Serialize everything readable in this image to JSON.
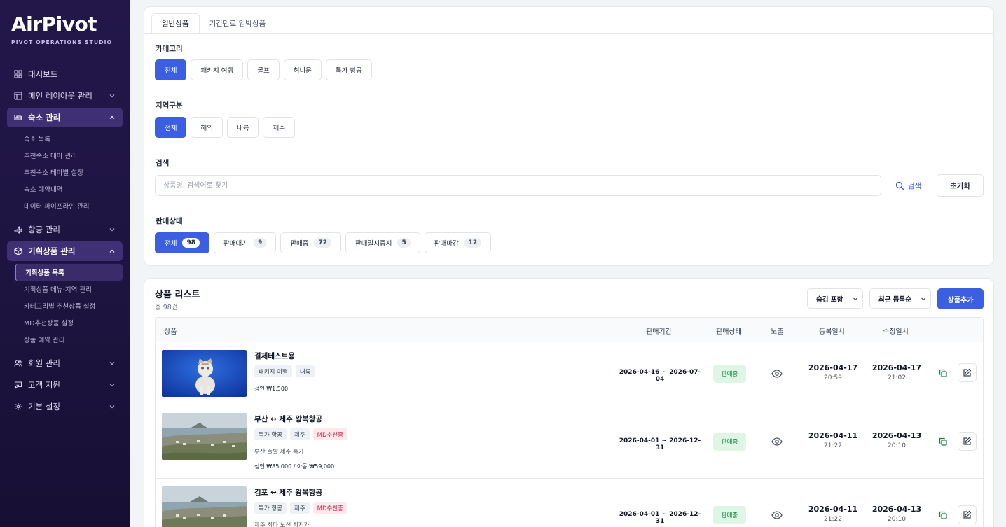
{
  "brand": {
    "name": "AirPivot",
    "tagline": "PIVOT OPERATIONS STUDIO"
  },
  "sidebar": {
    "items": [
      {
        "label": "대시보드",
        "icon": "grid-icon"
      },
      {
        "label": "메인 레이아웃 관리",
        "icon": "layout-icon"
      },
      {
        "label": "숙소 관리",
        "icon": "bed-icon"
      },
      {
        "label": "항공 관리",
        "icon": "plane-icon"
      },
      {
        "label": "기획상품 관리",
        "icon": "box-icon"
      },
      {
        "label": "회원 관리",
        "icon": "users-icon"
      },
      {
        "label": "고객 지원",
        "icon": "chat-icon"
      },
      {
        "label": "기본 설정",
        "icon": "gear-icon"
      }
    ],
    "lodging_sub": [
      "숙소 목록",
      "추천숙소 테마 관리",
      "추천숙소 테마별 설정",
      "숙소 예약내역",
      "데이터 파이프라인 관리"
    ],
    "product_sub": [
      "기획상품 목록",
      "기획상품 메뉴-지역 관리",
      "카테고리별 추천상품 설정",
      "MD추천상품 설정",
      "상품 예약 관리"
    ]
  },
  "tabs": [
    "일반상품",
    "기간만료 임박상품"
  ],
  "filters": {
    "category_label": "카테고리",
    "categories": [
      "전체",
      "패키지 여행",
      "골프",
      "허니문",
      "특가 항공"
    ],
    "region_label": "지역구분",
    "regions": [
      "전체",
      "해외",
      "내륙",
      "제주"
    ],
    "search_label": "검색",
    "search_placeholder": "상품명, 검색어로 찾기",
    "search_button": "검색",
    "reset_button": "초기화",
    "status_label": "판매상태",
    "statuses": [
      {
        "label": "전체",
        "count": "98"
      },
      {
        "label": "판매대기",
        "count": "9"
      },
      {
        "label": "판매중",
        "count": "72"
      },
      {
        "label": "판매일시중지",
        "count": "5"
      },
      {
        "label": "판매마감",
        "count": "12"
      }
    ]
  },
  "list": {
    "title": "상품 리스트",
    "count": "총 98건",
    "hidden_select": "숨김 포함",
    "sort_select": "최근 등록순",
    "add_button": "상품추가",
    "columns": [
      "상품",
      "판매기간",
      "판매상태",
      "노출",
      "등록일시",
      "수정일시"
    ],
    "rows": [
      {
        "name": "결제테스트용",
        "tags": [
          "패키지 여행",
          "내륙"
        ],
        "md": "",
        "desc": "",
        "price": "성인 ₩1,500",
        "period": "2026-04-16 ~ 2026-07-04",
        "status": "판매중",
        "reg_date": "2026-04-17",
        "reg_time": "20:59",
        "mod_date": "2026-04-17",
        "mod_time": "21:02"
      },
      {
        "name": "부산 ↔ 제주 왕복항공",
        "tags": [
          "특가 항공",
          "제주"
        ],
        "md": "MD추천중",
        "desc": "부산 출발 제주 특가",
        "price": "성인 ₩85,000 / 아동 ₩59,000",
        "period": "2026-04-01 ~ 2026-12-31",
        "status": "판매중",
        "reg_date": "2026-04-11",
        "reg_time": "21:22",
        "mod_date": "2026-04-13",
        "mod_time": "20:10"
      },
      {
        "name": "김포 ↔ 제주 왕복항공",
        "tags": [
          "특가 항공",
          "제주"
        ],
        "md": "MD추천중",
        "desc": "제주 최다 노선 최저가",
        "price": "",
        "period": "2026-04-01 ~ 2026-12-31",
        "status": "판매중",
        "reg_date": "2026-04-11",
        "reg_time": "21:22",
        "mod_date": "2026-04-13",
        "mod_time": "20:10"
      }
    ]
  },
  "colors": {
    "accent": "#3b5fe0",
    "sidebar": "#23174a",
    "status_bg": "#dff6e6",
    "md_tag": "#c0264a"
  }
}
